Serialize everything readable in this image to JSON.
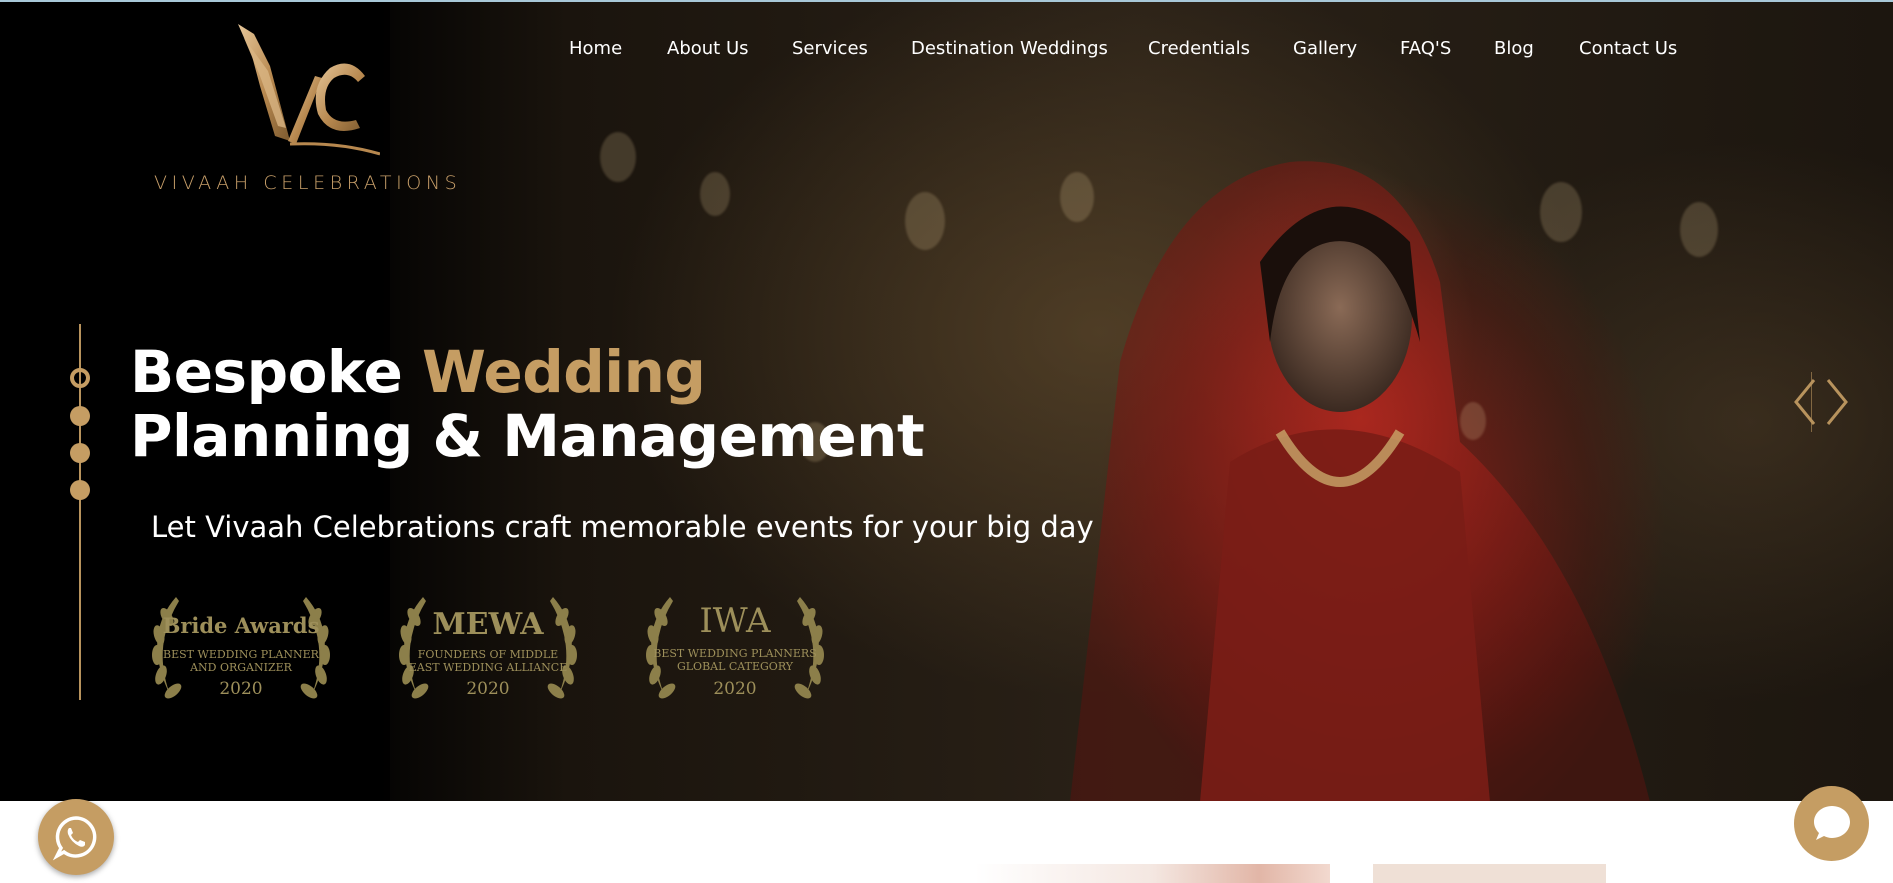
{
  "brand": {
    "name": "VIVAAH CELEBRATIONS",
    "monogram": "VC"
  },
  "nav": {
    "items": [
      {
        "label": "Home"
      },
      {
        "label": "About Us"
      },
      {
        "label": "Services"
      },
      {
        "label": "Destination Weddings"
      },
      {
        "label": "Credentials"
      },
      {
        "label": "Gallery"
      },
      {
        "label": "FAQ'S"
      },
      {
        "label": "Blog"
      },
      {
        "label": "Contact Us"
      }
    ]
  },
  "hero": {
    "headline_part1": "Bespoke ",
    "headline_highlight": "Wedding",
    "headline_line2": "Planning & Management",
    "subheadline": "Let Vivaah Celebrations craft memorable events for your big day",
    "slide_count": 4,
    "active_slide": 1
  },
  "awards": [
    {
      "title": "Bride Awards",
      "subtitle_line1": "BEST WEDDING PLANNER",
      "subtitle_line2": "AND ORGANIZER",
      "year": "2020"
    },
    {
      "title": "MEWA",
      "subtitle_line1": "FOUNDERS OF MIDDLE",
      "subtitle_line2": "EAST WEDDING ALLIANCE",
      "year": "2020"
    },
    {
      "title": "IWA",
      "subtitle_line1": "BEST WEDDING PLANNERS",
      "subtitle_line2": "GLOBAL CATEGORY",
      "year": "2020"
    }
  ],
  "controls": {
    "prev_icon": "chevron-left-icon",
    "next_icon": "chevron-right-icon",
    "whatsapp_icon": "whatsapp-icon",
    "chat_icon": "chat-bubble-icon"
  },
  "colors": {
    "accent_gold": "#c59d63",
    "award_olive": "#9d8f5a",
    "text_white": "#ffffff",
    "hero_dark": "#050403"
  }
}
